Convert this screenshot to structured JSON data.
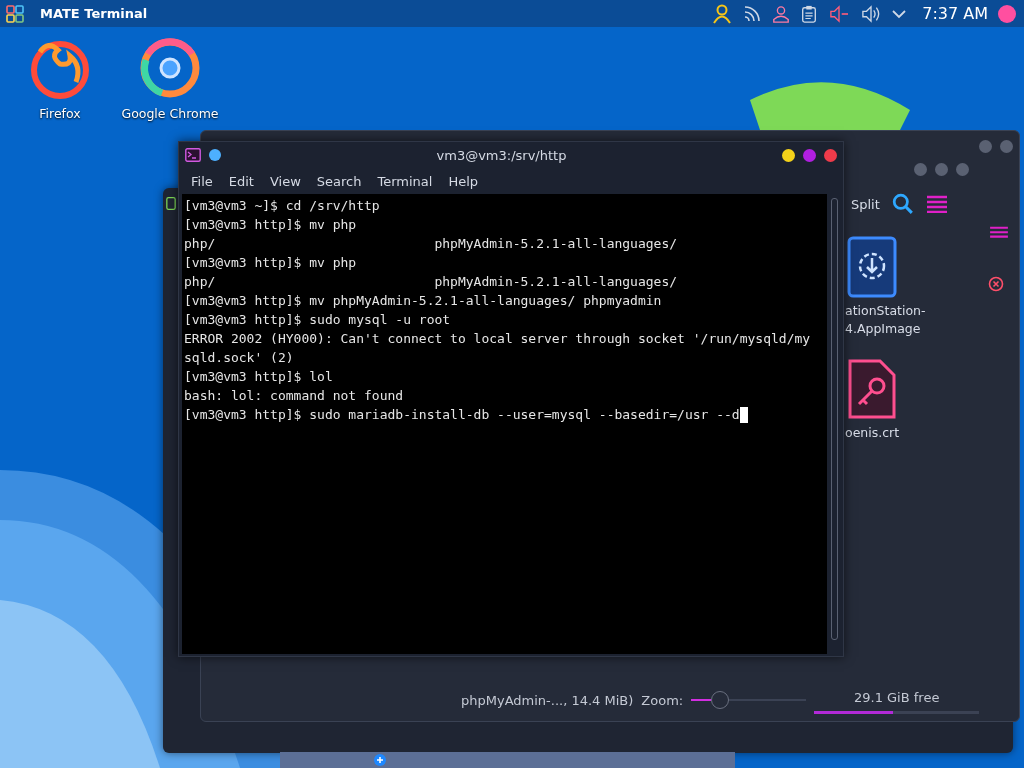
{
  "panel": {
    "app_title": "MATE Terminal",
    "clock": "7:37 AM"
  },
  "desktop_icons": [
    {
      "kind": "firefox",
      "label": "Firefox"
    },
    {
      "kind": "chrome",
      "label": "Google Chrome"
    }
  ],
  "file_manager": {
    "toolbar_label": "Split",
    "files": [
      {
        "kind": "appimage",
        "lines": [
          "ationStation-",
          "4.AppImage"
        ]
      },
      {
        "kind": "certificate",
        "lines": [
          "oenis.crt"
        ]
      }
    ],
    "status": "phpMyAdmin-..., 14.4 MiB)",
    "zoom_label": "Zoom:",
    "zoom": {
      "level": 0.25
    },
    "free_space": {
      "text": "29.1 GiB free",
      "level": 0.48
    }
  },
  "terminal": {
    "title": "vm3@vm3:/srv/http",
    "menu": [
      "File",
      "Edit",
      "View",
      "Search",
      "Terminal",
      "Help"
    ],
    "lines": [
      "[vm3@vm3 ~]$ cd /srv/http",
      "[vm3@vm3 http]$ mv php",
      "php/                            phpMyAdmin-5.2.1-all-languages/",
      "[vm3@vm3 http]$ mv php",
      "php/                            phpMyAdmin-5.2.1-all-languages/",
      "[vm3@vm3 http]$ mv phpMyAdmin-5.2.1-all-languages/ phpmyadmin",
      "[vm3@vm3 http]$ sudo mysql -u root",
      "ERROR 2002 (HY000): Can't connect to local server through socket '/run/mysqld/my",
      "sqld.sock' (2)",
      "[vm3@vm3 http]$ lol",
      "bash: lol: command not found",
      "[vm3@vm3 http]$ sudo mariadb-install-db --user=mysql --basedir=/usr --d"
    ],
    "cursor_on_last_line": true
  }
}
